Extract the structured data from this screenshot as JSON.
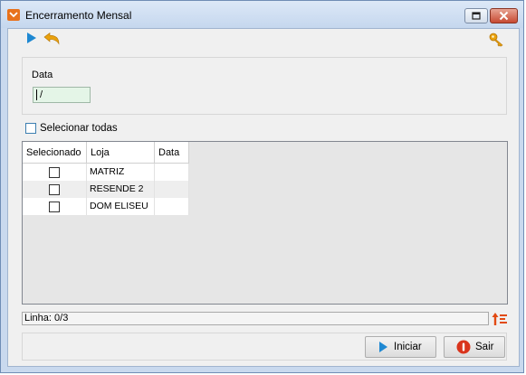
{
  "window": {
    "title": "Encerramento Mensal"
  },
  "toolbar": {
    "run_icon": "play-icon",
    "back_icon": "undo-arrow-icon",
    "key_icon": "key-icon"
  },
  "date_panel": {
    "label": "Data",
    "value": "/"
  },
  "select_all": {
    "label": "Selecionar todas",
    "checked": false
  },
  "grid": {
    "columns": [
      "Selecionado",
      "Loja",
      "Data"
    ],
    "rows": [
      {
        "checked": false,
        "loja": "MATRIZ",
        "data": ""
      },
      {
        "checked": false,
        "loja": "RESENDE 2",
        "data": ""
      },
      {
        "checked": false,
        "loja": "DOM ELISEU",
        "data": ""
      }
    ]
  },
  "status": {
    "text": "Linha: 0/3"
  },
  "buttons": {
    "iniciar": "Iniciar",
    "sair": "Sair"
  },
  "colors": {
    "accent_blue": "#1e88d2",
    "arrow_yellow": "#e9a10d",
    "stop_red": "#d9341c",
    "date_bg": "#e4f5e7"
  }
}
